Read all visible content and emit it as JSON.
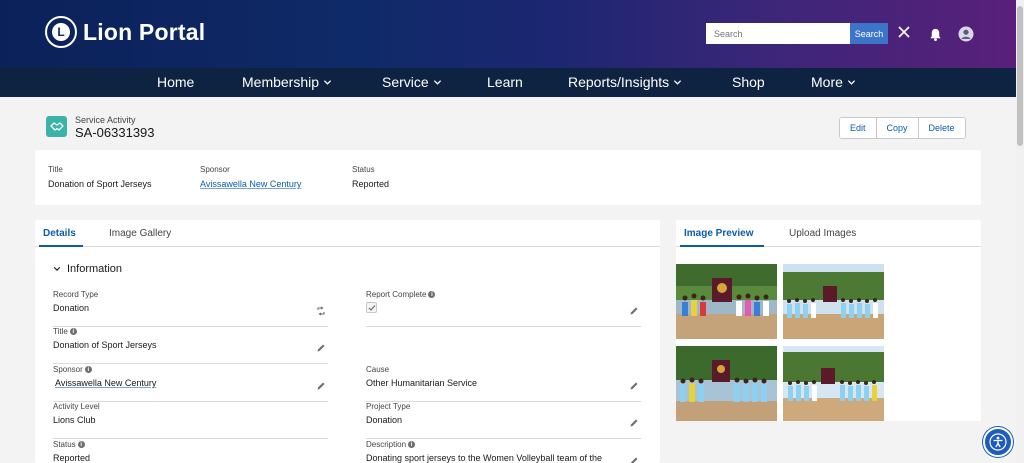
{
  "header": {
    "brand": "Lion Portal",
    "logo_letter": "L",
    "search_placeholder": "Search",
    "search_button": "Search"
  },
  "nav": {
    "items": [
      {
        "label": "Home",
        "has_menu": false
      },
      {
        "label": "Membership",
        "has_menu": true
      },
      {
        "label": "Service",
        "has_menu": true
      },
      {
        "label": "Learn",
        "has_menu": false
      },
      {
        "label": "Reports/Insights",
        "has_menu": true
      },
      {
        "label": "Shop",
        "has_menu": false
      },
      {
        "label": "More",
        "has_menu": true
      }
    ]
  },
  "record": {
    "type": "Service Activity",
    "id": "SA-06331393",
    "actions": [
      "Edit",
      "Copy",
      "Delete"
    ]
  },
  "highlights": {
    "title_label": "Title",
    "title_value": "Donation of Sport Jerseys",
    "sponsor_label": "Sponsor",
    "sponsor_value": "Avissawella New Century",
    "status_label": "Status",
    "status_value": "Reported"
  },
  "details": {
    "tabs": [
      "Details",
      "Image Gallery"
    ],
    "section_title": "Information",
    "fields": {
      "record_type": {
        "label": "Record Type",
        "value": "Donation"
      },
      "report_complete": {
        "label": "Report Complete",
        "checked": true
      },
      "title": {
        "label": "Title",
        "value": "Donation of Sport Jerseys"
      },
      "sponsor": {
        "label": "Sponsor",
        "value": "Avissawella New Century"
      },
      "cause": {
        "label": "Cause",
        "value": "Other Humanitarian Service"
      },
      "activity_level": {
        "label": "Activity Level",
        "value": "Lions Club"
      },
      "project_type": {
        "label": "Project Type",
        "value": "Donation"
      },
      "status": {
        "label": "Status",
        "value": "Reported"
      },
      "description": {
        "label": "Description",
        "value": "Donating sport jerseys to the Women Volleyball team of the"
      }
    }
  },
  "images": {
    "tabs": [
      "Image Preview",
      "Upload Images"
    ]
  },
  "colors": {
    "brand_link": "#0b5cab",
    "nav_bg": "#0e2342",
    "record_icon": "#3bb4a8"
  }
}
